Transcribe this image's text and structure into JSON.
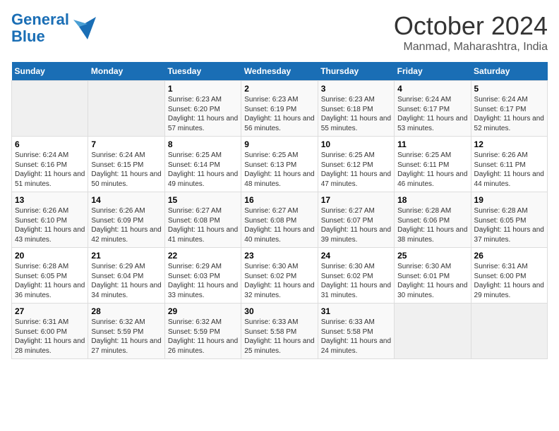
{
  "header": {
    "logo_line1": "General",
    "logo_line2": "Blue",
    "month": "October 2024",
    "location": "Manmad, Maharashtra, India"
  },
  "weekdays": [
    "Sunday",
    "Monday",
    "Tuesday",
    "Wednesday",
    "Thursday",
    "Friday",
    "Saturday"
  ],
  "weeks": [
    [
      {
        "day": "",
        "info": ""
      },
      {
        "day": "",
        "info": ""
      },
      {
        "day": "1",
        "info": "Sunrise: 6:23 AM\nSunset: 6:20 PM\nDaylight: 11 hours and 57 minutes."
      },
      {
        "day": "2",
        "info": "Sunrise: 6:23 AM\nSunset: 6:19 PM\nDaylight: 11 hours and 56 minutes."
      },
      {
        "day": "3",
        "info": "Sunrise: 6:23 AM\nSunset: 6:18 PM\nDaylight: 11 hours and 55 minutes."
      },
      {
        "day": "4",
        "info": "Sunrise: 6:24 AM\nSunset: 6:17 PM\nDaylight: 11 hours and 53 minutes."
      },
      {
        "day": "5",
        "info": "Sunrise: 6:24 AM\nSunset: 6:17 PM\nDaylight: 11 hours and 52 minutes."
      }
    ],
    [
      {
        "day": "6",
        "info": "Sunrise: 6:24 AM\nSunset: 6:16 PM\nDaylight: 11 hours and 51 minutes."
      },
      {
        "day": "7",
        "info": "Sunrise: 6:24 AM\nSunset: 6:15 PM\nDaylight: 11 hours and 50 minutes."
      },
      {
        "day": "8",
        "info": "Sunrise: 6:25 AM\nSunset: 6:14 PM\nDaylight: 11 hours and 49 minutes."
      },
      {
        "day": "9",
        "info": "Sunrise: 6:25 AM\nSunset: 6:13 PM\nDaylight: 11 hours and 48 minutes."
      },
      {
        "day": "10",
        "info": "Sunrise: 6:25 AM\nSunset: 6:12 PM\nDaylight: 11 hours and 47 minutes."
      },
      {
        "day": "11",
        "info": "Sunrise: 6:25 AM\nSunset: 6:11 PM\nDaylight: 11 hours and 46 minutes."
      },
      {
        "day": "12",
        "info": "Sunrise: 6:26 AM\nSunset: 6:11 PM\nDaylight: 11 hours and 44 minutes."
      }
    ],
    [
      {
        "day": "13",
        "info": "Sunrise: 6:26 AM\nSunset: 6:10 PM\nDaylight: 11 hours and 43 minutes."
      },
      {
        "day": "14",
        "info": "Sunrise: 6:26 AM\nSunset: 6:09 PM\nDaylight: 11 hours and 42 minutes."
      },
      {
        "day": "15",
        "info": "Sunrise: 6:27 AM\nSunset: 6:08 PM\nDaylight: 11 hours and 41 minutes."
      },
      {
        "day": "16",
        "info": "Sunrise: 6:27 AM\nSunset: 6:08 PM\nDaylight: 11 hours and 40 minutes."
      },
      {
        "day": "17",
        "info": "Sunrise: 6:27 AM\nSunset: 6:07 PM\nDaylight: 11 hours and 39 minutes."
      },
      {
        "day": "18",
        "info": "Sunrise: 6:28 AM\nSunset: 6:06 PM\nDaylight: 11 hours and 38 minutes."
      },
      {
        "day": "19",
        "info": "Sunrise: 6:28 AM\nSunset: 6:05 PM\nDaylight: 11 hours and 37 minutes."
      }
    ],
    [
      {
        "day": "20",
        "info": "Sunrise: 6:28 AM\nSunset: 6:05 PM\nDaylight: 11 hours and 36 minutes."
      },
      {
        "day": "21",
        "info": "Sunrise: 6:29 AM\nSunset: 6:04 PM\nDaylight: 11 hours and 34 minutes."
      },
      {
        "day": "22",
        "info": "Sunrise: 6:29 AM\nSunset: 6:03 PM\nDaylight: 11 hours and 33 minutes."
      },
      {
        "day": "23",
        "info": "Sunrise: 6:30 AM\nSunset: 6:02 PM\nDaylight: 11 hours and 32 minutes."
      },
      {
        "day": "24",
        "info": "Sunrise: 6:30 AM\nSunset: 6:02 PM\nDaylight: 11 hours and 31 minutes."
      },
      {
        "day": "25",
        "info": "Sunrise: 6:30 AM\nSunset: 6:01 PM\nDaylight: 11 hours and 30 minutes."
      },
      {
        "day": "26",
        "info": "Sunrise: 6:31 AM\nSunset: 6:00 PM\nDaylight: 11 hours and 29 minutes."
      }
    ],
    [
      {
        "day": "27",
        "info": "Sunrise: 6:31 AM\nSunset: 6:00 PM\nDaylight: 11 hours and 28 minutes."
      },
      {
        "day": "28",
        "info": "Sunrise: 6:32 AM\nSunset: 5:59 PM\nDaylight: 11 hours and 27 minutes."
      },
      {
        "day": "29",
        "info": "Sunrise: 6:32 AM\nSunset: 5:59 PM\nDaylight: 11 hours and 26 minutes."
      },
      {
        "day": "30",
        "info": "Sunrise: 6:33 AM\nSunset: 5:58 PM\nDaylight: 11 hours and 25 minutes."
      },
      {
        "day": "31",
        "info": "Sunrise: 6:33 AM\nSunset: 5:58 PM\nDaylight: 11 hours and 24 minutes."
      },
      {
        "day": "",
        "info": ""
      },
      {
        "day": "",
        "info": ""
      }
    ]
  ]
}
